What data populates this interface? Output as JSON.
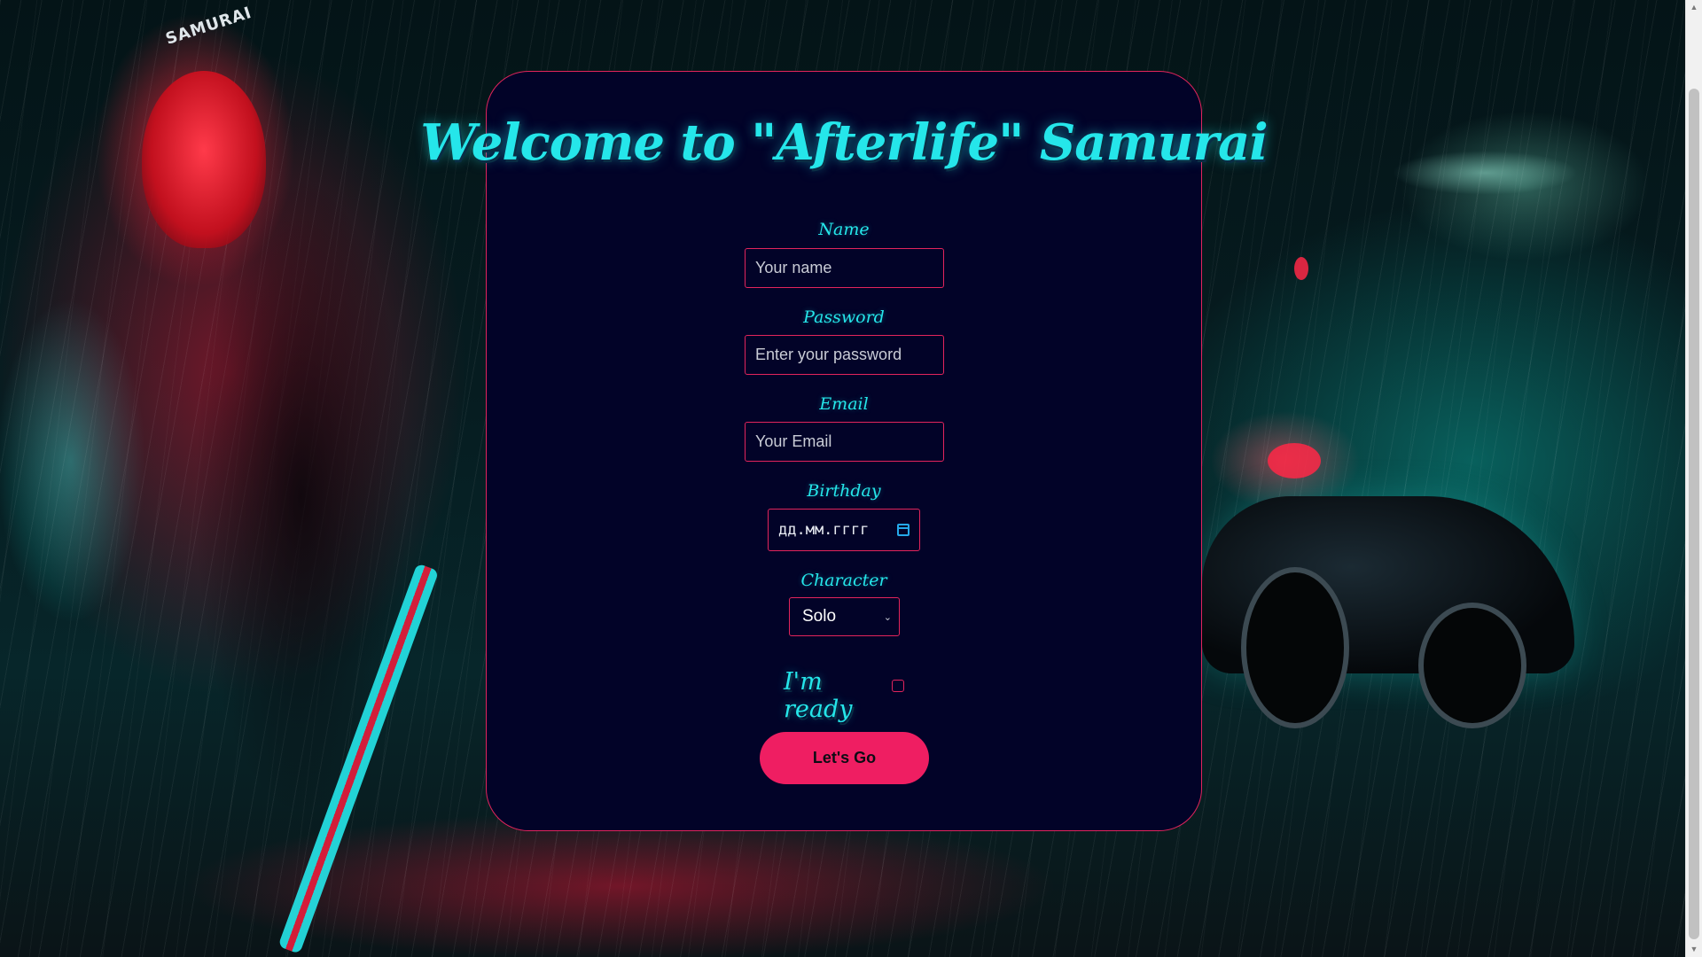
{
  "page": {
    "title": "Welcome to \"Afterlife\" Samurai",
    "background_logo": "SAMURAI"
  },
  "form": {
    "name": {
      "label": "Name",
      "placeholder": "Your name",
      "value": ""
    },
    "password": {
      "label": "Password",
      "placeholder": "Enter your password",
      "value": ""
    },
    "email": {
      "label": "Email",
      "placeholder": "Your Email",
      "value": ""
    },
    "birthday": {
      "label": "Birthday",
      "placeholder": "дд.мм.гггг",
      "icon": "calendar-icon"
    },
    "character": {
      "label": "Character",
      "selected": "Solo",
      "icon": "chevron-down-icon"
    },
    "ready": {
      "label": "I'm ready",
      "checked": false
    },
    "submit": {
      "label": "Let's Go"
    }
  },
  "colors": {
    "accent_cyan": "#25e6ea",
    "accent_pink": "#e2245c",
    "button_pink": "#ef1e62",
    "card_background": "#020328"
  }
}
